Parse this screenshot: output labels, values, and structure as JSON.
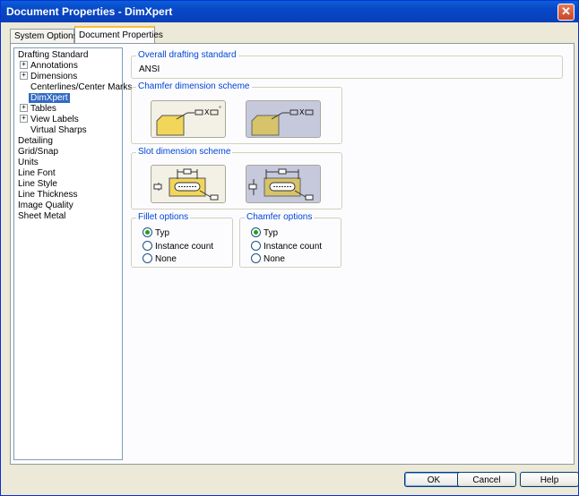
{
  "window": {
    "title": "Document Properties - DimXpert"
  },
  "tabs": [
    {
      "label": "System Options"
    },
    {
      "label": "Document Properties"
    }
  ],
  "tree": {
    "items": [
      {
        "label": "Drafting Standard"
      },
      {
        "label": "Annotations"
      },
      {
        "label": "Dimensions"
      },
      {
        "label": "Centerlines/Center Marks"
      },
      {
        "label": "DimXpert"
      },
      {
        "label": "Tables"
      },
      {
        "label": "View Labels"
      },
      {
        "label": "Virtual Sharps"
      },
      {
        "label": "Detailing"
      },
      {
        "label": "Grid/Snap"
      },
      {
        "label": "Units"
      },
      {
        "label": "Line Font"
      },
      {
        "label": "Line Style"
      },
      {
        "label": "Line Thickness"
      },
      {
        "label": "Image Quality"
      },
      {
        "label": "Sheet Metal"
      }
    ]
  },
  "overall": {
    "legend": "Overall drafting standard",
    "value": "ANSI"
  },
  "chamfer_scheme": {
    "legend": "Chamfer dimension scheme"
  },
  "slot_scheme": {
    "legend": "Slot dimension scheme"
  },
  "fillet_options": {
    "legend": "Fillet options",
    "options": [
      {
        "label": "Typ"
      },
      {
        "label": "Instance count"
      },
      {
        "label": "None"
      }
    ],
    "selected": "Typ"
  },
  "chamfer_options": {
    "legend": "Chamfer options",
    "options": [
      {
        "label": "Typ"
      },
      {
        "label": "Instance count"
      },
      {
        "label": "None"
      }
    ],
    "selected": "Typ"
  },
  "buttons": {
    "ok": "OK",
    "cancel": "Cancel",
    "help": "Help"
  },
  "colors": {
    "title_bar": "#0a4fd0",
    "selection": "#316ac5",
    "legend_text": "#0046d5",
    "radio_dot": "#21a121"
  }
}
